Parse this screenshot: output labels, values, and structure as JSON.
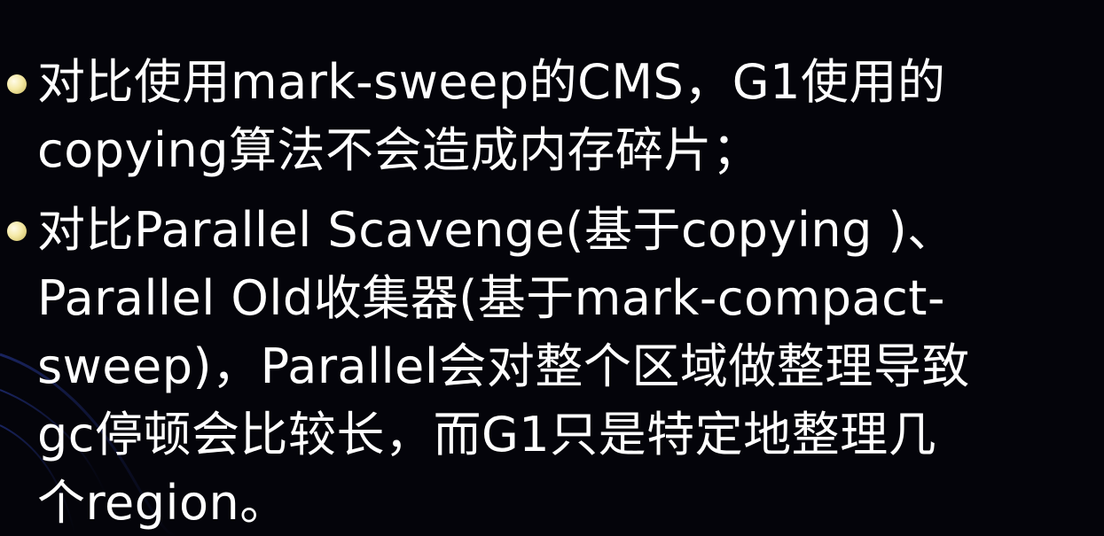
{
  "slide": {
    "bullets": [
      {
        "lines": [
          "对比使用mark-sweep的CMS，G1使用的",
          "copying算法不会造成内存碎片；"
        ]
      },
      {
        "lines": [
          "对比Parallel Scavenge(基于copying )、",
          "Parallel Old收集器(基于mark-compact-",
          "sweep)，Parallel会对整个区域做整理导致",
          "gc停顿会比较长，而G1只是特定地整理几",
          "个region。"
        ]
      }
    ]
  },
  "colors": {
    "background": "#04040a",
    "text": "#ffffff",
    "bullet": "#f4e9a6",
    "swirl": "#2b3fa8"
  }
}
